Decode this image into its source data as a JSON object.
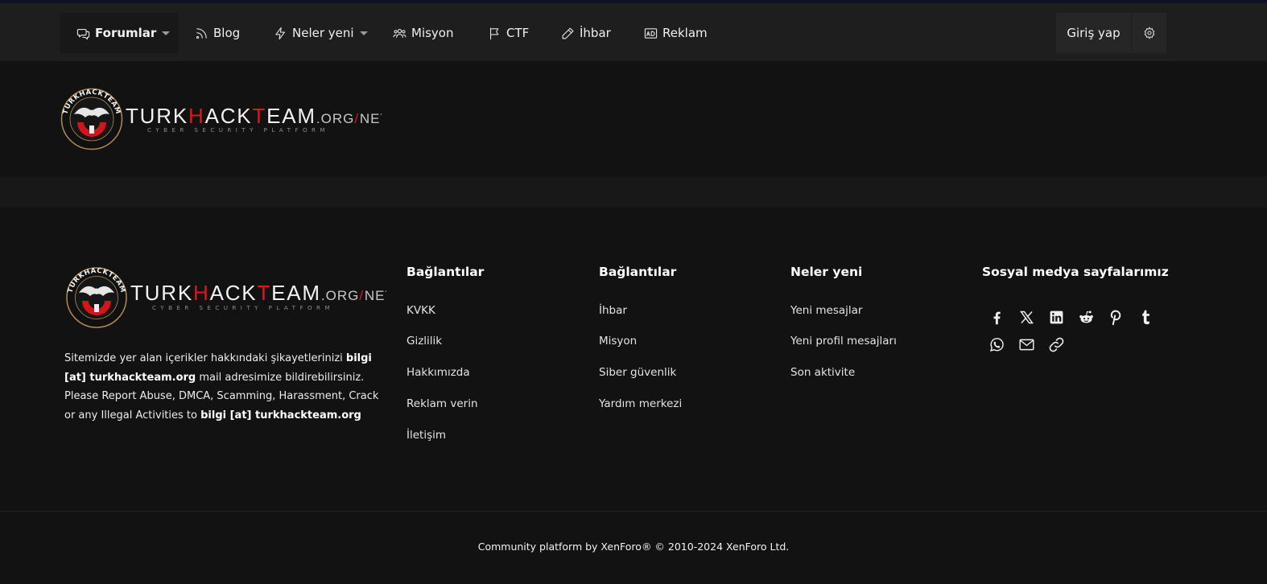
{
  "nav": {
    "items": [
      {
        "label": "Forumlar",
        "icon": "chat-icon"
      },
      {
        "label": "Blog",
        "icon": "rss-icon"
      },
      {
        "label": "Neler yeni",
        "icon": "bolt-icon"
      },
      {
        "label": "Misyon",
        "icon": "users-icon"
      },
      {
        "label": "CTF",
        "icon": "flag-icon"
      },
      {
        "label": "İhbar",
        "icon": "pencil-icon"
      },
      {
        "label": "Reklam",
        "icon": "ad-icon"
      }
    ],
    "login": "Giriş yap",
    "settings_icon": "gear-icon"
  },
  "logo": {
    "word_pre": "TURK",
    "word_mid": "H",
    "word_post": "ACK",
    "word_t": "T",
    "word_end": "EAM",
    "suffix_org": ".ORG",
    "slash": "/",
    "suffix_net": "NET",
    "tagline": "CYBER SECURITY PLATFORM",
    "badge_text": "TURKHACKTEAM",
    "accent": "#e0161e"
  },
  "footer": {
    "columns": [
      {
        "title": "Bağlantılar",
        "links": [
          "KVKK",
          "Gizlilik",
          "Hakkımızda",
          "Reklam verin",
          "İletişim"
        ]
      },
      {
        "title": "Bağlantılar",
        "links": [
          "İhbar",
          "Misyon",
          "Siber güvenlik",
          "Yardım merkezi"
        ]
      },
      {
        "title": "Neler yeni",
        "links": [
          "Yeni mesajlar",
          "Yeni profil mesajları",
          "Son aktivite"
        ]
      }
    ],
    "social_title": "Sosyal medya sayfalarımız",
    "social_icons": [
      "facebook-icon",
      "x-icon",
      "linkedin-icon",
      "reddit-icon",
      "pinterest-icon",
      "tumblr-icon",
      "whatsapp-icon",
      "email-icon",
      "link-icon"
    ],
    "desc": {
      "p1": "Sitemizde yer alan içerikler hakkındaki şikayetlerinizi ",
      "b1": "bilgi [at] turkhackteam.org",
      "p2": " mail adresimize bildirebilirsiniz. Please Report Abuse, DMCA, Scamming, Harassment, Crack or any Illegal Activities to ",
      "b2": "bilgi [at] turkhackteam.org"
    },
    "copyright": "Community platform by XenForo® © 2010-2024 XenForo Ltd."
  },
  "colors": {
    "background": "#121212",
    "navbar": "#1e1e1e",
    "text": "#e8e8e8"
  }
}
